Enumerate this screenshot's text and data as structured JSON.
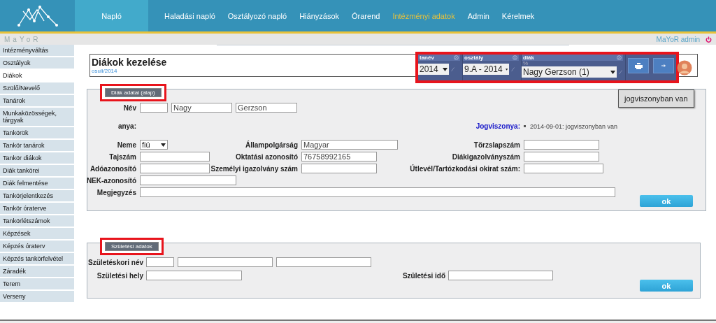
{
  "header": {
    "nav": [
      {
        "label": "Napló",
        "selected": true,
        "current": false
      },
      {
        "label": "Haladási napló",
        "selected": false,
        "current": false
      },
      {
        "label": "Osztályozó napló",
        "selected": false,
        "current": false
      },
      {
        "label": "Hiányzások",
        "selected": false,
        "current": false
      },
      {
        "label": "Órarend",
        "selected": false,
        "current": false
      },
      {
        "label": "Intézményi adatok",
        "selected": false,
        "current": true
      },
      {
        "label": "Admin",
        "selected": false,
        "current": false
      },
      {
        "label": "Kérelmek",
        "selected": false,
        "current": false
      }
    ]
  },
  "subbar": {
    "brand": "MaYoR",
    "user": "MaYoR admin"
  },
  "sidebar": {
    "items": [
      {
        "label": "Intézményváltás",
        "selected": false
      },
      {
        "label": "Osztályok",
        "selected": false
      },
      {
        "label": "Diákok",
        "selected": true
      },
      {
        "label": "Szülő/Nevelő",
        "selected": false
      },
      {
        "label": "Tanárok",
        "selected": false
      },
      {
        "label": "Munkaközösségek, tárgyak",
        "selected": false
      },
      {
        "label": "Tankörök",
        "selected": false
      },
      {
        "label": "Tankör tanárok",
        "selected": false
      },
      {
        "label": "Tankör diákok",
        "selected": false
      },
      {
        "label": "Diák tankörei",
        "selected": false
      },
      {
        "label": "Diák felmentése",
        "selected": false
      },
      {
        "label": "Tankörjelentkezés",
        "selected": false
      },
      {
        "label": "Tankör óraterve",
        "selected": false
      },
      {
        "label": "Tankörlétszámok",
        "selected": false
      },
      {
        "label": "Képzések",
        "selected": false
      },
      {
        "label": "Képzés óraterv",
        "selected": false
      },
      {
        "label": "Képzés tankörfelvétel",
        "selected": false
      },
      {
        "label": "Záradék",
        "selected": false
      },
      {
        "label": "Terem",
        "selected": false
      },
      {
        "label": "Verseny",
        "selected": false
      }
    ]
  },
  "page": {
    "title": "Diákok kezelése",
    "subtitle": "osuli/2014"
  },
  "selector": {
    "highlighted": true,
    "school_year": {
      "label": "tanév",
      "value": "2014"
    },
    "class": {
      "label": "osztály",
      "value": "9.A - 2014"
    },
    "student": {
      "label": "diák",
      "filter": "%",
      "value": "Nagy Gerzson (1)"
    }
  },
  "tooltip": "jogviszonyban van",
  "basic_data": {
    "legend": "Diák adatai (alap)",
    "highlighted": true,
    "name": {
      "label": "Név",
      "values": [
        "Nagy",
        "Gerzson"
      ]
    },
    "mother": {
      "label": "anya:"
    },
    "legal_status": {
      "label": "Jogviszonya:",
      "entries": [
        "2014-09-01: jogviszonyban van"
      ]
    },
    "gender": {
      "label": "Neme",
      "value": "fiú"
    },
    "citizenship": {
      "label": "Állampolgárság",
      "value": "Magyar"
    },
    "register_number": {
      "label": "Törzslapszám"
    },
    "taj_number": {
      "label": "Tajszám"
    },
    "education_id": {
      "label": "Oktatási azonosító",
      "value": "76758992165"
    },
    "student_card_number": {
      "label": "Diákigazolványszám"
    },
    "tax_id": {
      "label": "Adóazonosító"
    },
    "id_card_number": {
      "label": "Személyi igazolvány szám"
    },
    "passport_number": {
      "label": "Útlevél/Tartózkodási okirat szám:"
    },
    "nek_id": {
      "label": "NEK-azonosító"
    },
    "note": {
      "label": "Megjegyzés"
    },
    "submit": "ok"
  },
  "birth_data": {
    "legend": "Születési adatok",
    "highlighted": true,
    "birth_name": {
      "label": "Születéskori név"
    },
    "birth_place": {
      "label": "Születési hely"
    },
    "birth_date": {
      "label": "Születési idő"
    },
    "submit": "ok"
  }
}
